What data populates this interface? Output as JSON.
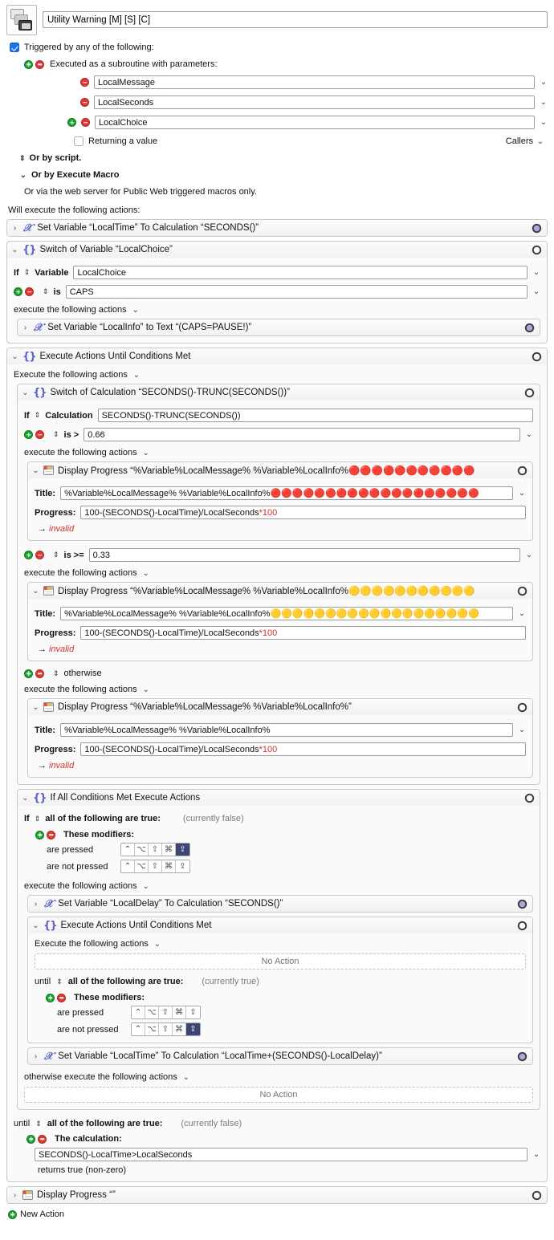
{
  "macro": {
    "icon_name": "macro-group-icon",
    "name": "Utility Warning [M] [S] [C]"
  },
  "trigger": {
    "checkbox_label": "Triggered by any of the following:",
    "subroutine_label": "Executed as a subroutine with parameters:",
    "parameters": [
      "LocalMessage",
      "LocalSeconds",
      "LocalChoice"
    ],
    "returning_label": "Returning a value",
    "callers_label": "Callers",
    "or_script": "Or by script.",
    "or_execute_macro": "Or by Execute Macro",
    "or_web": "Or via the web server for Public Web triggered macros only."
  },
  "will_execute": "Will execute the following actions:",
  "actions": {
    "set_local_time": {
      "title": "Set Variable “LocalTime” To Calculation “SECONDS()”"
    },
    "switch_local_choice": {
      "title": "Switch of Variable “LocalChoice”",
      "if_label": "If",
      "kind_label": "Variable",
      "variable_value": "LocalChoice",
      "is_label": "is",
      "case_value": "CAPS",
      "execute_label": "execute the following actions",
      "inner_action": "Set Variable “LocalInfo” to Text “(CAPS=PAUSE!)”"
    },
    "loop_outer": {
      "title": "Execute Actions Until Conditions Met",
      "execute_label": "Execute the following actions",
      "until_label": "until",
      "until_condition": "all of the following are true:",
      "until_state": "(currently false)",
      "calc_label": "The calculation:",
      "calc_value": "SECONDS()-LocalTime>LocalSeconds",
      "returns_label": "returns true (non-zero)"
    },
    "switch_calc": {
      "title": "Switch of Calculation “SECONDS()-TRUNC(SECONDS())”",
      "if_label": "If",
      "kind_label": "Calculation",
      "calculation_value": "SECONDS()-TRUNC(SECONDS())",
      "execute_label": "execute the following actions",
      "cases": [
        {
          "op": "is >",
          "value": "0.66"
        },
        {
          "op": "is >=",
          "value": "0.33"
        }
      ],
      "otherwise_label": "otherwise"
    },
    "display_progress_red": {
      "title_prefix": "Display Progress “%Variable%LocalMessage% %Variable%LocalInfo%",
      "title_dots": "…",
      "title_label": "Title:",
      "title_value_prefix": "%Variable%LocalMessage% %Variable%LocalInfo%",
      "emoji": "🔴",
      "emoji_count_header": 13,
      "emoji_count_field": 19,
      "progress_label": "Progress:",
      "progress_value": "100-(SECONDS()-LocalTime)/LocalSeconds",
      "progress_suffix": "*100",
      "invalid": "invalid"
    },
    "display_progress_yellow": {
      "title_prefix": "Display Progress “%Variable%LocalMessage% %Variable%LocalInfo%",
      "title_dots": "…",
      "title_label": "Title:",
      "title_value_prefix": "%Variable%LocalMessage% %Variable%LocalInfo%",
      "emoji": "🟡",
      "emoji_count_header": 13,
      "emoji_count_field": 19,
      "progress_label": "Progress:",
      "progress_value": "100-(SECONDS()-LocalTime)/LocalSeconds",
      "progress_suffix": "*100",
      "invalid": "invalid"
    },
    "display_progress_plain": {
      "title": "Display Progress “%Variable%LocalMessage% %Variable%LocalInfo%”",
      "title_label": "Title:",
      "title_value": "%Variable%LocalMessage% %Variable%LocalInfo%",
      "progress_label": "Progress:",
      "progress_value": "100-(SECONDS()-LocalTime)/LocalSeconds",
      "progress_suffix": "*100",
      "invalid": "invalid"
    },
    "if_all_conditions": {
      "title": "If All Conditions Met Execute Actions",
      "if_label": "If",
      "condition": "all of the following are true:",
      "state": "(currently false)",
      "modifiers_label": "These modifiers:",
      "are_pressed_label": "are pressed",
      "are_not_pressed_label": "are not pressed",
      "execute_label": "execute the following actions",
      "otherwise_execute_label": "otherwise execute the following actions",
      "no_action": "No Action"
    },
    "set_local_delay": {
      "title": "Set Variable “LocalDelay” To Calculation “SECONDS()”"
    },
    "loop_inner": {
      "title": "Execute Actions Until Conditions Met",
      "execute_label": "Execute the following actions",
      "no_action": "No Action",
      "until_label": "until",
      "until_condition": "all of the following are true:",
      "until_state": "(currently true)",
      "modifiers_label": "These modifiers:",
      "are_pressed_label": "are pressed",
      "are_not_pressed_label": "are not pressed"
    },
    "set_local_time_2": {
      "title": "Set Variable “LocalTime” To Calculation “LocalTime+(SECONDS()-LocalDelay)”"
    },
    "display_progress_empty": {
      "title": "Display Progress “”"
    }
  },
  "modifier_keys": {
    "glyphs": [
      "⌃",
      "⌥",
      "⇧",
      "⌘",
      "⇪"
    ],
    "names": [
      "control-key",
      "option-key",
      "shift-key",
      "command-key",
      "caps-lock-key"
    ],
    "if_all_pressed_selected": [
      false,
      false,
      false,
      false,
      true
    ],
    "if_all_not_pressed_selected": [
      false,
      false,
      false,
      false,
      false
    ],
    "loop_pressed_selected": [
      false,
      false,
      false,
      false,
      false
    ],
    "loop_not_pressed_selected": [
      false,
      false,
      false,
      false,
      true
    ]
  },
  "footer": {
    "new_action": "New Action"
  },
  "colors": {
    "accent_blue": "#1a73e8",
    "icon_purple": "#5b63c4",
    "add_green": "#19a32f",
    "remove_red": "#dc3a36",
    "invalid_red": "#d0342c",
    "modifier_selected": "#3d4672"
  }
}
